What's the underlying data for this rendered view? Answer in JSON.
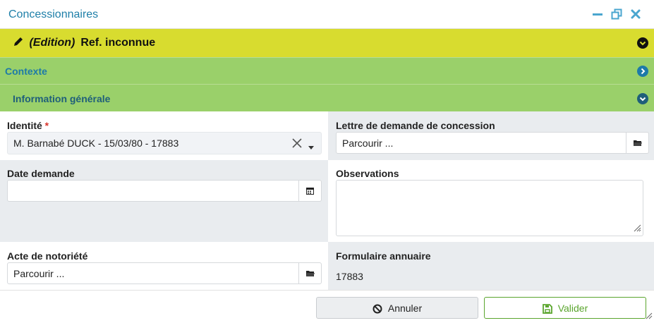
{
  "window": {
    "title": "Concessionnaires",
    "controls": {
      "minimize_icon": "minimize-icon",
      "restore_icon": "restore-icon",
      "close_icon": "close-icon",
      "accent": "#4aa6cf"
    }
  },
  "header": {
    "mode": "(Edition)",
    "ref": "Ref. inconnue",
    "icon": "pencil-icon"
  },
  "sections": {
    "contexte": {
      "label": "Contexte",
      "state": "collapsed"
    },
    "info": {
      "label": "Information générale",
      "state": "expanded"
    }
  },
  "form": {
    "identite": {
      "label": "Identité",
      "required_mark": "*",
      "value": "M. Barnabé DUCK - 15/03/80 - 17883"
    },
    "lettre": {
      "label": "Lettre de demande de concession",
      "value": "Parcourir ..."
    },
    "date_demande": {
      "label": "Date demande",
      "value": ""
    },
    "observations": {
      "label": "Observations",
      "value": ""
    },
    "acte": {
      "label": "Acte de notoriété",
      "value": "Parcourir ..."
    },
    "formulaire": {
      "label": "Formulaire annuaire",
      "value": "17883"
    }
  },
  "footer": {
    "cancel_label": "Annuler",
    "validate_label": "Valider"
  },
  "colors": {
    "edit_bar": "#d8dc2f",
    "section_bar": "#9ad06a",
    "link_blue": "#1e7fa8",
    "validate_green": "#5aa52d",
    "panel_grey": "#e9ecef"
  }
}
